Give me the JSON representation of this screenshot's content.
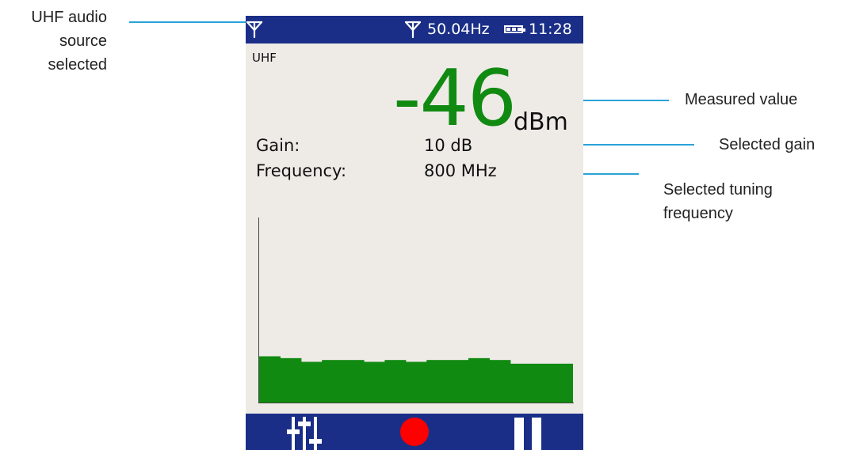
{
  "annotations": {
    "source_line1": "UHF audio",
    "source_line2": "source",
    "source_line3": "selected",
    "measured": "Measured value",
    "gain": "Selected gain",
    "freq_line1": "Selected tuning",
    "freq_line2": "frequency"
  },
  "status_bar": {
    "frequency": "50.04Hz",
    "time": "11:28",
    "left_icon": "antenna-icon",
    "right_icon": "antenna-icon",
    "battery_icon": "battery-icon"
  },
  "screen": {
    "source": "UHF",
    "measured_value": "-46",
    "unit": "dBm",
    "gain_label": "Gain:",
    "gain_value": "10 dB",
    "frequency_label": "Frequency:",
    "frequency_value": "800 MHz"
  },
  "chart_data": {
    "type": "bar",
    "title": "",
    "xlabel": "",
    "ylabel": "",
    "values": [
      0.25,
      0.24,
      0.22,
      0.23,
      0.23,
      0.22,
      0.23,
      0.22,
      0.23,
      0.23,
      0.24,
      0.23,
      0.21,
      0.21,
      0.21
    ],
    "ylim": [
      0,
      1
    ],
    "color": "#118a11"
  },
  "nav_bar": {
    "icons": [
      "mixer-sliders-icon",
      "record-icon",
      "pause-icon"
    ],
    "record_color": "#ff0000"
  },
  "colors": {
    "status_bar": "#1a2e88",
    "value_green": "#118a11",
    "annotation_line": "#29a3d8",
    "screen_bg": "#eeebe7"
  }
}
